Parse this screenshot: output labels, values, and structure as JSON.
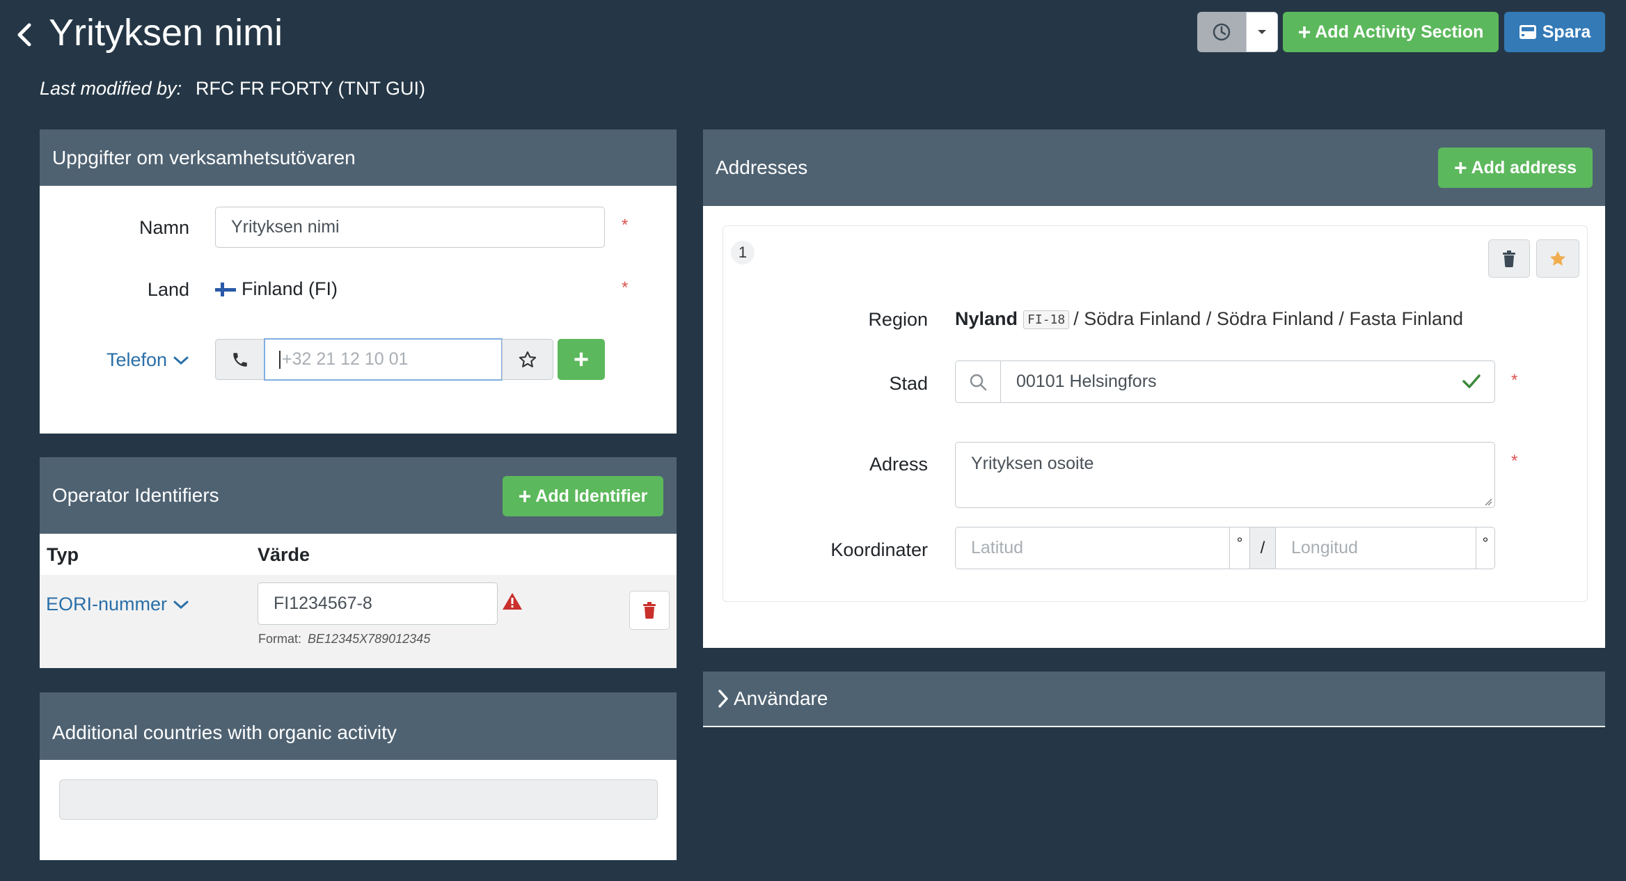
{
  "header": {
    "title": "Yrityksen nimi",
    "last_modified_label": "Last modified by:",
    "last_modified_value": "RFC FR FORTY (TNT GUI)",
    "add_activity_label": "Add Activity Section",
    "save_label": "Spara"
  },
  "operator_panel": {
    "title": "Uppgifter om verksamhetsutövaren",
    "name_label": "Namn",
    "name_value": "Yrityksen nimi",
    "country_label": "Land",
    "country_value": "Finland (FI)",
    "phone_label": "Telefon",
    "phone_placeholder": "+32 21 12 10 01",
    "required_mark": "*"
  },
  "identifiers_panel": {
    "title": "Operator Identifiers",
    "add_label": "Add Identifier",
    "col_type": "Typ",
    "col_value": "Värde",
    "rows": [
      {
        "type": "EORI-nummer",
        "value": "FI1234567-8",
        "format_label": "Format:",
        "format_value": "BE12345X789012345"
      }
    ]
  },
  "countries_panel": {
    "title": "Additional countries with organic activity"
  },
  "addresses_panel": {
    "title": "Addresses",
    "add_label": "Add address",
    "items": [
      {
        "number": "1",
        "region_label": "Region",
        "region_name": "Nyland",
        "region_code": "FI-18",
        "region_path": "/ Södra Finland / Södra Finland / Fasta Finland",
        "city_label": "Stad",
        "city_value": "00101 Helsingfors",
        "address_label": "Adress",
        "address_value": "Yrityksen osoite",
        "coords_label": "Koordinater",
        "lat_placeholder": "Latitud",
        "lon_placeholder": "Longitud",
        "degree": "°",
        "separator": "/"
      }
    ]
  },
  "users_panel": {
    "title": "Användare"
  },
  "colors": {
    "background": "#253746",
    "panel_header": "#4f6272",
    "green": "#5cb85c",
    "blue": "#337ab7",
    "danger": "#d9534f",
    "star": "#f0ad4e"
  }
}
